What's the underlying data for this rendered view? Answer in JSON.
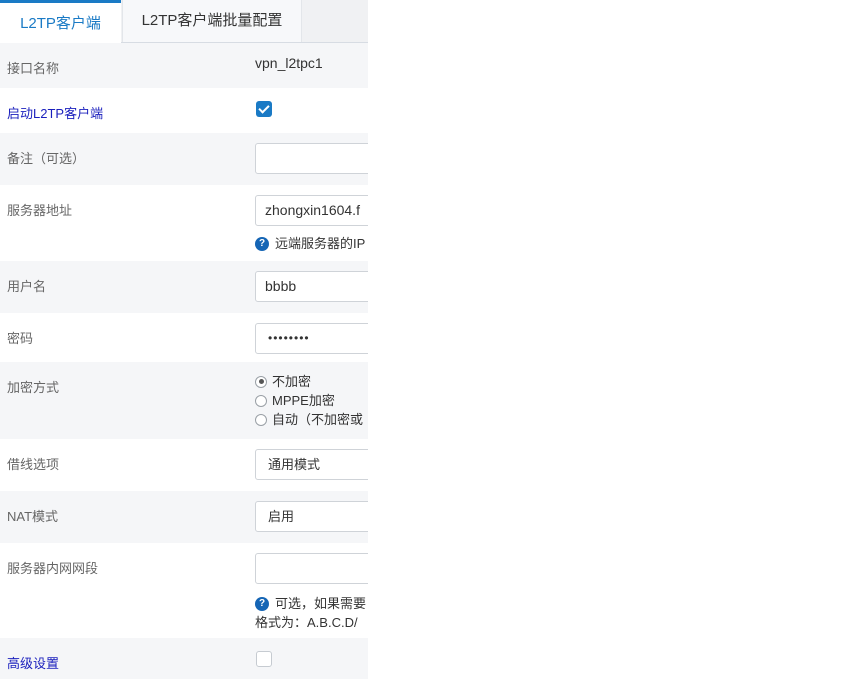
{
  "tabs": [
    {
      "label": "L2TP客户端",
      "active": true
    },
    {
      "label": "L2TP客户端批量配置",
      "active": false
    }
  ],
  "interface_name": {
    "label": "接口名称",
    "value": "vpn_l2tpc1"
  },
  "enable_client": {
    "label": "启动L2TP客户端",
    "checked": true
  },
  "remark": {
    "label": "备注（可选）",
    "value": ""
  },
  "server_address": {
    "label": "服务器地址",
    "value": "zhongxin1604.f",
    "help": "远端服务器的IP"
  },
  "username": {
    "label": "用户名",
    "value": "bbbb"
  },
  "password": {
    "label": "密码",
    "value": "••••••••"
  },
  "encryption": {
    "label": "加密方式",
    "options": [
      {
        "label": "不加密",
        "selected": true
      },
      {
        "label": "MPPE加密",
        "selected": false
      },
      {
        "label": "自动（不加密或",
        "selected": false
      }
    ]
  },
  "line_option": {
    "label": "借线选项",
    "value": "通用模式"
  },
  "nat_mode": {
    "label": "NAT模式",
    "value": "启用"
  },
  "server_lan": {
    "label": "服务器内网网段",
    "value": "",
    "help_line1": "可选，如果需要",
    "help_line2": "格式为：A.B.C.D/"
  },
  "advanced": {
    "label": "高级设置",
    "checked": false
  },
  "colors": {
    "accent": "#1a7ac5",
    "link_label": "#1a1fbd",
    "row_gray": "#f5f6f8",
    "help_icon": "#1565b5"
  }
}
